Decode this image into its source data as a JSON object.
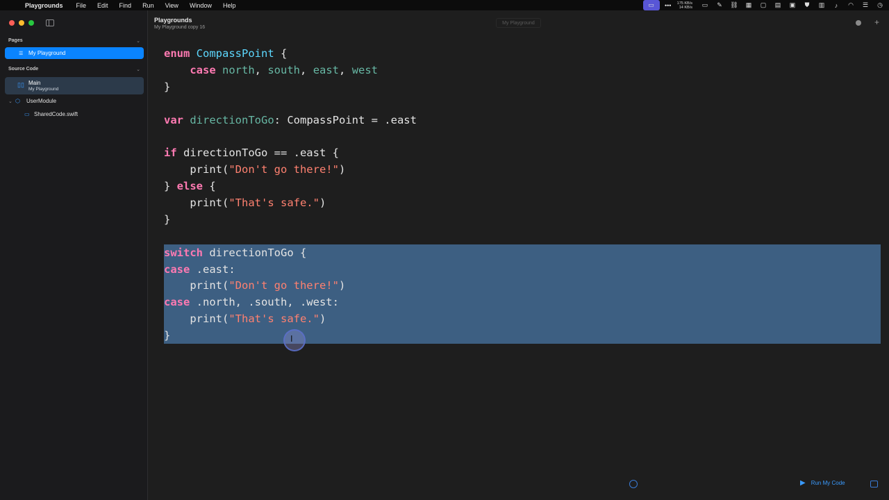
{
  "menubar": {
    "app_name": "Playgrounds",
    "menus": [
      "File",
      "Edit",
      "Find",
      "Run",
      "View",
      "Window",
      "Help"
    ],
    "net_up": "175 KB/s",
    "net_down": "14 KB/s"
  },
  "sidebar": {
    "pages_header": "Pages",
    "page_item": "My Playground",
    "source_header": "Source Code",
    "main_title": "Main",
    "main_subtitle": "My Playground",
    "module": "UserModule",
    "file": "SharedCode.swift"
  },
  "editor": {
    "title": "Playgrounds",
    "subtitle": "My Playground copy 16",
    "tab_label": "My Playground",
    "run_label": "Run My Code"
  },
  "code": {
    "l1_kw": "enum",
    "l1_type": "CompassPoint",
    "l1_rest": " {",
    "l2_kw": "case",
    "l2_c1": "north",
    "l2_c2": "south",
    "l2_c3": "east",
    "l2_c4": "west",
    "l3": "}",
    "l5_kw": "var",
    "l5_id": "directionToGo",
    "l5_rest": ": CompassPoint = .east",
    "l7_kw": "if",
    "l7_rest": " directionToGo == .east {",
    "l8_fn": "print(",
    "l8_str": "\"Don't go there!\"",
    "l8_end": ")",
    "l9_pre": "} ",
    "l9_kw": "else",
    "l9_rest": " {",
    "l10_fn": "print(",
    "l10_str": "\"That's safe.\"",
    "l10_end": ")",
    "l11": "}",
    "l13_kw": "switch",
    "l13_rest": " directionToGo {",
    "l14_kw": "case",
    "l14_rest": " .east:",
    "l15_fn": "print(",
    "l15_str": "\"Don't go there!\"",
    "l15_end": ")",
    "l16_kw": "case",
    "l16_rest": " .north, .south, .west:",
    "l17_fn": "print(",
    "l17_str": "\"That's safe.\"",
    "l17_end": ")",
    "l18": "}"
  },
  "colors": {
    "accent": "#0a84ff",
    "keyword": "#ff7ab2",
    "type": "#5dd8ff",
    "string": "#ff8170",
    "selection": "#3d5f82"
  }
}
